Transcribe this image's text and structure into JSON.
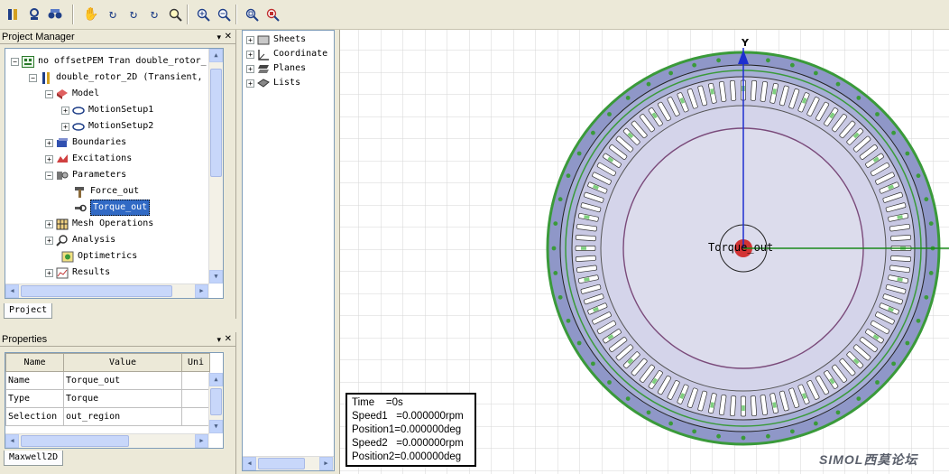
{
  "toolbar": {
    "icons": [
      "toolbar-icon-1",
      "toolbar-icon-2",
      "toolbar-icon-3",
      "pan-hand-icon",
      "rotate-icon",
      "rotate-2-icon",
      "rotate-3-icon",
      "zoom-area-icon",
      "zoom-in-icon",
      "zoom-out-icon",
      "fit-all-icon",
      "fit-selection-icon"
    ]
  },
  "project_manager": {
    "title": "Project Manager",
    "tab_label": "Project",
    "items": [
      {
        "label": "no offsetPEM Tran double_rotor_"
      },
      {
        "label": "double_rotor_2D (Transient,"
      },
      {
        "label": "Model"
      },
      {
        "label": "MotionSetup1"
      },
      {
        "label": "MotionSetup2"
      },
      {
        "label": "Boundaries"
      },
      {
        "label": "Excitations"
      },
      {
        "label": "Parameters"
      },
      {
        "label": "Force_out"
      },
      {
        "label": "Torque_out"
      },
      {
        "label": "Mesh Operations"
      },
      {
        "label": "Analysis"
      },
      {
        "label": "Optimetrics"
      },
      {
        "label": "Results"
      }
    ]
  },
  "model_tree": {
    "items": [
      {
        "label": "Sheets"
      },
      {
        "label": "Coordinate"
      },
      {
        "label": "Planes"
      },
      {
        "label": "Lists"
      }
    ]
  },
  "properties": {
    "title": "Properties",
    "tab_label": "Maxwell2D",
    "columns": [
      "Name",
      "Value",
      "Uni"
    ],
    "rows": [
      [
        "Name",
        "Torque_out",
        ""
      ],
      [
        "Type",
        "Torque",
        ""
      ],
      [
        "Selection",
        "out_region",
        ""
      ]
    ]
  },
  "viewport": {
    "axis_label": "Y",
    "object_label": "Torque_out",
    "info": {
      "time": "Time    =0s",
      "speed1": "Speed1   =0.000000rpm",
      "position1": "Position1=0.000000deg",
      "speed2": "Speed2   =0.000000rpm",
      "position2": "Position2=0.000000deg"
    },
    "brand": "SIMOL西莫论坛"
  },
  "colors": {
    "outer_ring": "#8f97c8",
    "green": "#3a9a3a",
    "inner_disc": "#dcdcec",
    "axis_blue": "#1e2fd0",
    "axis_green": "#1a8a1a",
    "highlight": "#316ac5"
  }
}
